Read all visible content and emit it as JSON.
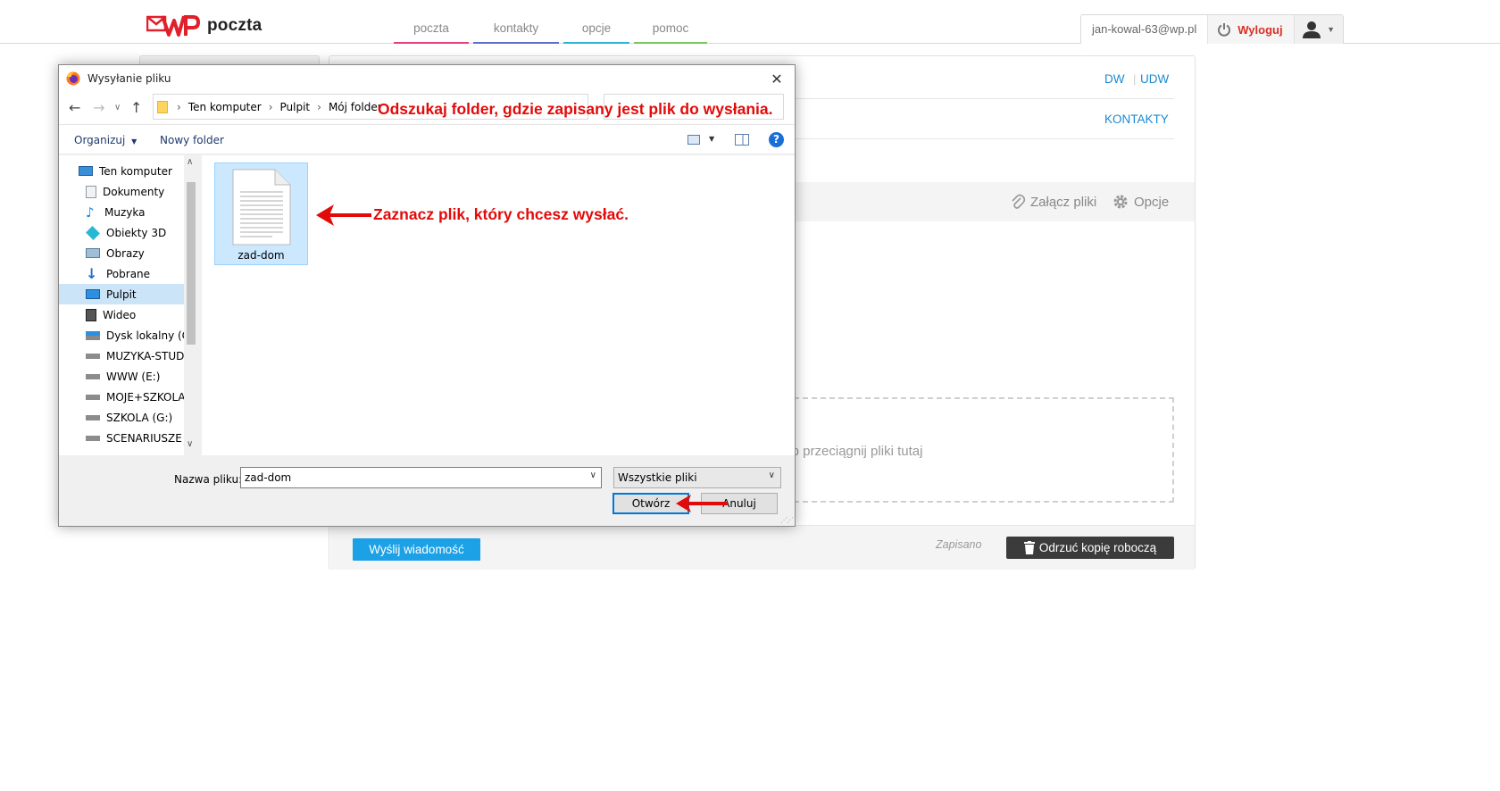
{
  "header": {
    "logo_text": "poczta",
    "nav": [
      {
        "label": "poczta",
        "color": "#e0407b"
      },
      {
        "label": "kontakty",
        "color": "#5a70c8"
      },
      {
        "label": "opcje",
        "color": "#2cb3d9"
      },
      {
        "label": "pomoc",
        "color": "#7cc45c"
      }
    ],
    "user_email": "jan-kowal-63@wp.pl",
    "logout_label": "Wyloguj"
  },
  "compose": {
    "dw_label": "DW",
    "udw_label": "UDW",
    "contacts_label": "KONTAKTY",
    "attach_label": "Załącz pliki",
    "options_label": "Opcje",
    "drop_text": "lub przeciągnij pliki tutaj",
    "send_label": "Wyślij wiadomość",
    "saved_label": "Zapisano",
    "discard_label": "Odrzuć kopię roboczą"
  },
  "dialog": {
    "title": "Wysyłanie pliku",
    "breadcrumb": [
      "Ten komputer",
      "Pulpit",
      "Mój folder"
    ],
    "organize_label": "Organizuj",
    "new_folder_label": "Nowy folder",
    "nav_items": [
      {
        "label": "Ten komputer",
        "icon": "computer-icon"
      },
      {
        "label": "Dokumenty",
        "icon": "documents-icon"
      },
      {
        "label": "Muzyka",
        "icon": "music-icon"
      },
      {
        "label": "Obiekty 3D",
        "icon": "cube-icon"
      },
      {
        "label": "Obrazy",
        "icon": "pictures-icon"
      },
      {
        "label": "Pobrane",
        "icon": "download-icon"
      },
      {
        "label": "Pulpit",
        "icon": "desktop-icon",
        "selected": true
      },
      {
        "label": "Wideo",
        "icon": "video-icon"
      },
      {
        "label": "Dysk lokalny (C:)",
        "icon": "drive-icon"
      },
      {
        "label": "MUZYKA-STUDIO",
        "icon": "drive-icon"
      },
      {
        "label": "WWW (E:)",
        "icon": "drive-icon"
      },
      {
        "label": "MOJE+SZKOLA (",
        "icon": "drive-icon"
      },
      {
        "label": "SZKOLA (G:)",
        "icon": "drive-icon"
      },
      {
        "label": "SCENARIUSZE (H",
        "icon": "drive-icon"
      }
    ],
    "file_name": "zad-dom",
    "filename_label": "Nazwa pliku:",
    "filename_value": "zad-dom",
    "filetype_value": "Wszystkie pliki",
    "open_label": "Otwórz",
    "cancel_label": "Anuluj"
  },
  "annotations": {
    "folder_hint": "Odszukaj folder, gdzie zapisany jest plik do wysłania.",
    "file_hint": "Zaznacz plik, który chcesz wysłać."
  },
  "colors": {
    "accent_blue": "#1da1e6",
    "logout_red": "#d93025",
    "annotation_red": "#e30a0a"
  }
}
